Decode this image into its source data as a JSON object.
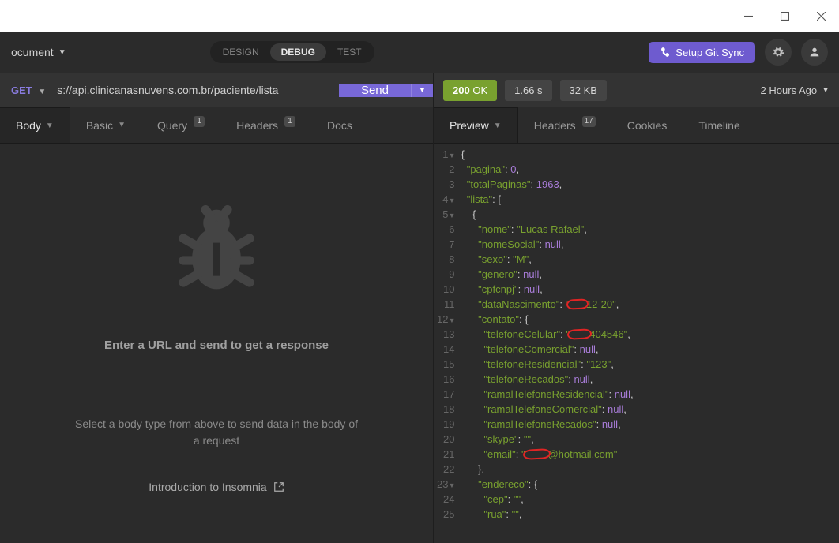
{
  "window": {
    "doc_label": "ocument"
  },
  "modes": {
    "design": "DESIGN",
    "debug": "DEBUG",
    "test": "TEST"
  },
  "git_button": "Setup Git Sync",
  "request": {
    "method": "GET",
    "url": "s://api.clinicanasnuvens.com.br/paciente/lista",
    "send": "Send"
  },
  "left_tabs": {
    "body": "Body",
    "basic": "Basic",
    "query": "Query",
    "query_badge": "1",
    "headers": "Headers",
    "headers_badge": "1",
    "docs": "Docs"
  },
  "empty": {
    "lead": "Enter a URL and send to get a response",
    "sub": "Select a body type from above to send data in the body of a request",
    "intro": "Introduction to Insomnia"
  },
  "response": {
    "status_code": "200",
    "status_text": "OK",
    "time": "1.66 s",
    "size": "32 KB",
    "age": "2 Hours Ago"
  },
  "right_tabs": {
    "preview": "Preview",
    "headers": "Headers",
    "headers_badge": "17",
    "cookies": "Cookies",
    "timeline": "Timeline"
  },
  "json": {
    "pagina_k": "pagina",
    "pagina_v": "0",
    "totalPaginas_k": "totalPaginas",
    "totalPaginas_v": "1963",
    "lista_k": "lista",
    "nome_k": "nome",
    "nome_v": "Lucas Rafael",
    "nomeSocial_k": "nomeSocial",
    "sexo_k": "sexo",
    "sexo_v": "M",
    "genero_k": "genero",
    "cpfcnpj_k": "cpfcnpj",
    "dataNascimento_k": "dataNascimento",
    "dataNascimento_redacted_tail": "12-20",
    "contato_k": "contato",
    "telefoneCelular_k": "telefoneCelular",
    "telefoneCelular_redacted_tail": "404546",
    "telefoneComercial_k": "telefoneComercial",
    "telefoneResidencial_k": "telefoneResidencial",
    "telefoneResidencial_v": "123",
    "telefoneRecados_k": "telefoneRecados",
    "ramalResidencial_k": "ramalTelefoneResidencial",
    "ramalComercial_k": "ramalTelefoneComercial",
    "ramalRecados_k": "ramalTelefoneRecados",
    "skype_k": "skype",
    "email_k": "email",
    "email_redacted_tail": "@hotmail.com",
    "endereco_k": "endereco",
    "cep_k": "cep",
    "rua_k": "rua",
    "null": "null"
  }
}
